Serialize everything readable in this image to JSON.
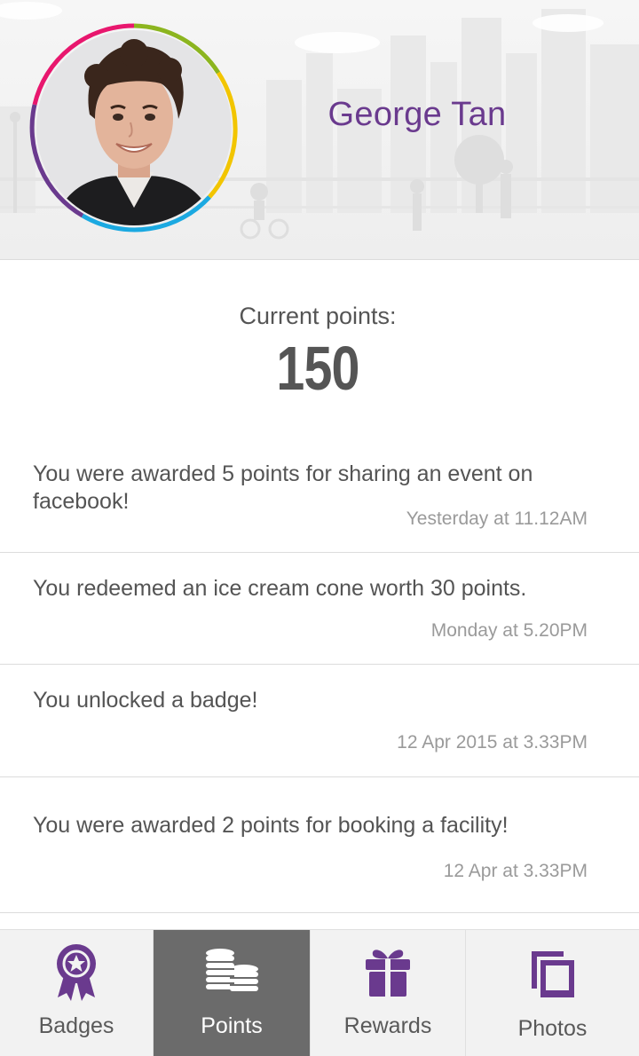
{
  "profile": {
    "name": "George Tan"
  },
  "points": {
    "label": "Current points:",
    "value": "150"
  },
  "activities": [
    {
      "text": "You were awarded 5 points for sharing an event on facebook!",
      "time": "Yesterday at 11.12AM"
    },
    {
      "text": "You redeemed an ice cream cone worth 30 points.",
      "time": "Monday at 5.20PM"
    },
    {
      "text": "You unlocked a badge!",
      "time": "12 Apr 2015 at 3.33PM"
    },
    {
      "text": "You were awarded 2 points for booking a facility!",
      "time": "12 Apr at 3.33PM"
    }
  ],
  "nav": {
    "tabs": [
      {
        "label": "Badges",
        "icon": "ribbon-badge-icon"
      },
      {
        "label": "Points",
        "icon": "coin-stacks-icon",
        "active": true
      },
      {
        "label": "Rewards",
        "icon": "gift-icon"
      },
      {
        "label": "Photos",
        "icon": "photo-stack-icon"
      }
    ]
  },
  "colors": {
    "accent": "#6a3a8e",
    "active_tab": "#6b6b6b",
    "ring_segments": [
      "#e8176e",
      "#8cb51f",
      "#f2c500",
      "#1ba9e1",
      "#6a3a8e"
    ]
  }
}
